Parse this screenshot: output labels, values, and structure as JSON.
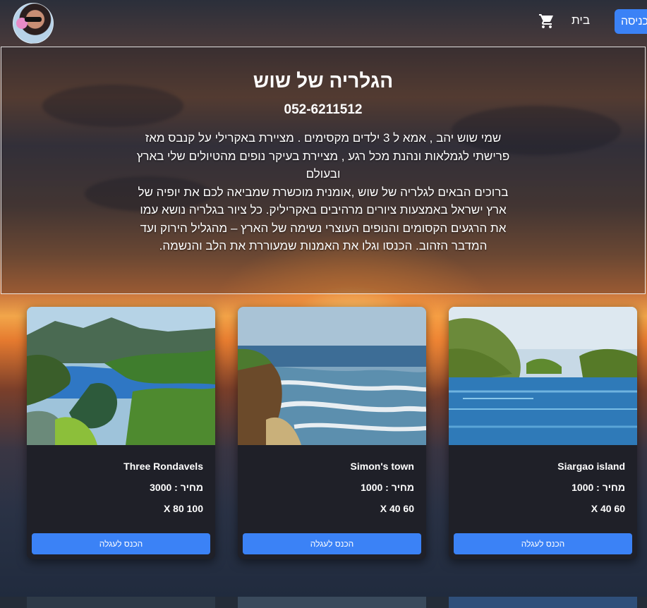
{
  "nav": {
    "home_label": "בית",
    "login_label": "כניסה",
    "avatar_icon": "avatar-photo",
    "cart_icon": "shopping-cart-icon"
  },
  "intro": {
    "title": "הגלריה של שוש",
    "phone": "052-6211512",
    "bio_line1": "שמי שוש יהב , אמא ל 3 ילדים מקסימים . מציירת באקרילי על קנבס מאז פרישתי לגמלאות ונהנת מכל רגע , מציירת בעיקר נופים מהטיולים שלי בארץ ובעולם",
    "bio_line2": "ברוכים הבאים לגלריה של שוש ,אומנית מוכשרת שמביאה לכם את יופיה של ארץ ישראל באמצעות ציורים מרהיבים באקריליק. כל ציור בגלריה נושא עמו את הרגעים הקסומים והנופים העוצרי נשימה של הארץ – מהגליל הירוק ועד המדבר הזהוב. הכנסו וגלו את האמנות שמעוררת את הלב והנשמה."
  },
  "products": [
    {
      "title": "Three Rondavels",
      "price": "מחיר : 3000",
      "size": "100 X 80",
      "button": "הכנס לעגלה"
    },
    {
      "title": "Simon's town",
      "price": "מחיר : 1000",
      "size": "60 X 40",
      "button": "הכנס לעגלה"
    },
    {
      "title": "Siargao island",
      "price": "מחיר : 1000",
      "size": "60 X 40",
      "button": "הכנס לעגלה"
    }
  ],
  "colors": {
    "accent": "#3b82f6",
    "card_bg": "#1f2028"
  }
}
